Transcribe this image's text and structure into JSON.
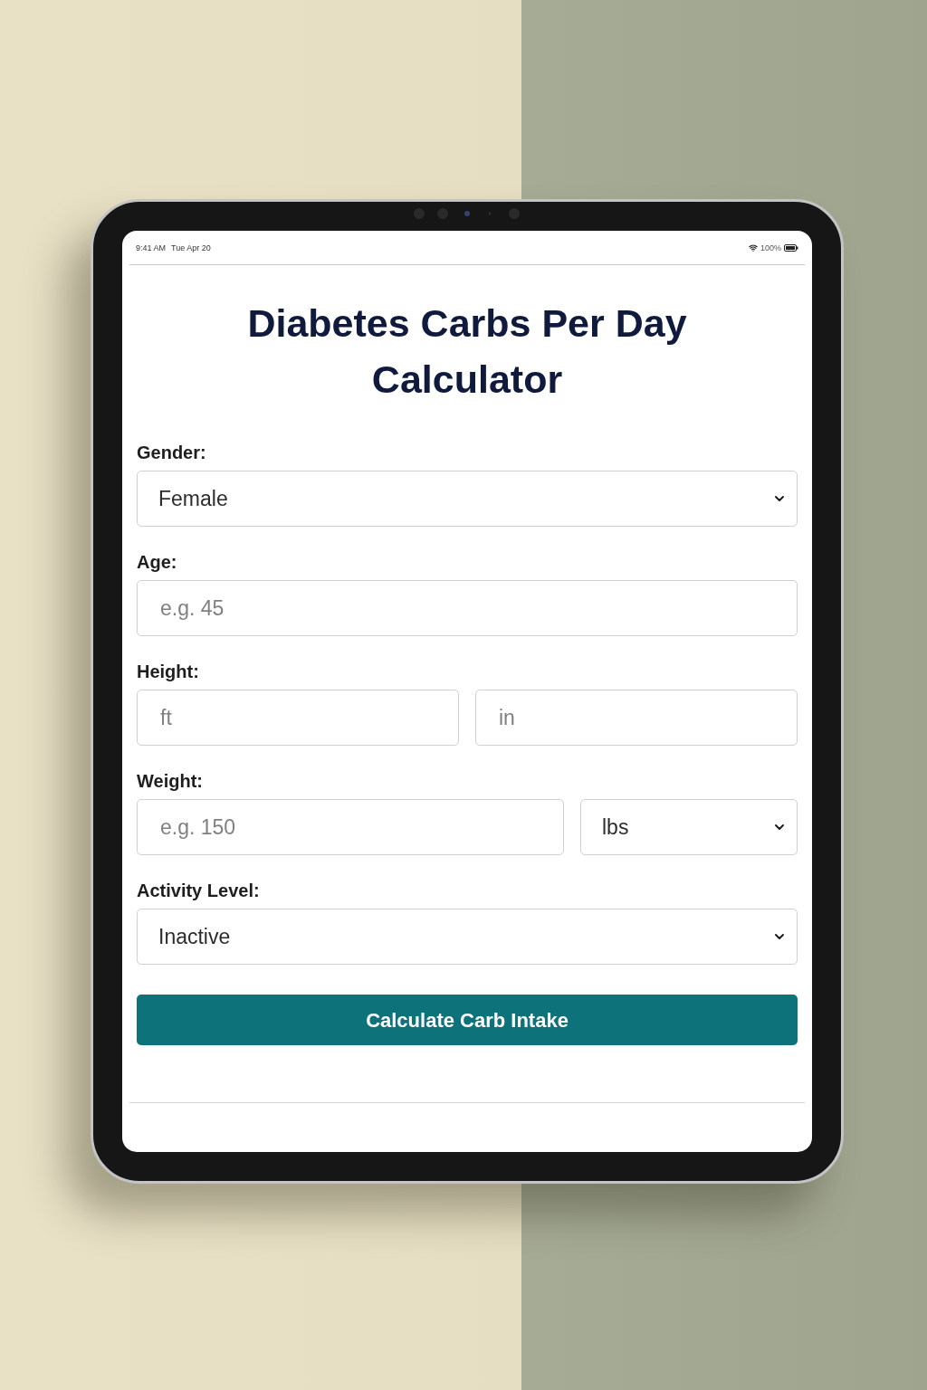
{
  "status_bar": {
    "time": "9:41 AM",
    "date": "Tue Apr 20",
    "battery": "100%"
  },
  "title": "Diabetes Carbs Per Day Calculator",
  "fields": [
    {
      "label": "Gender:",
      "controls": [
        {
          "kind": "select",
          "value": "Female"
        }
      ]
    },
    {
      "label": "Age:",
      "controls": [
        {
          "kind": "input",
          "placeholder": "e.g. 45"
        }
      ]
    },
    {
      "label": "Height:",
      "controls": [
        {
          "kind": "input",
          "placeholder": "ft"
        },
        {
          "kind": "input",
          "placeholder": "in"
        }
      ]
    },
    {
      "label": "Weight:",
      "controls": [
        {
          "kind": "input",
          "placeholder": "e.g. 150"
        },
        {
          "kind": "select",
          "value": "lbs"
        }
      ]
    },
    {
      "label": "Activity Level:",
      "controls": [
        {
          "kind": "select",
          "value": "Inactive"
        }
      ]
    }
  ],
  "button": "Calculate Carb Intake"
}
